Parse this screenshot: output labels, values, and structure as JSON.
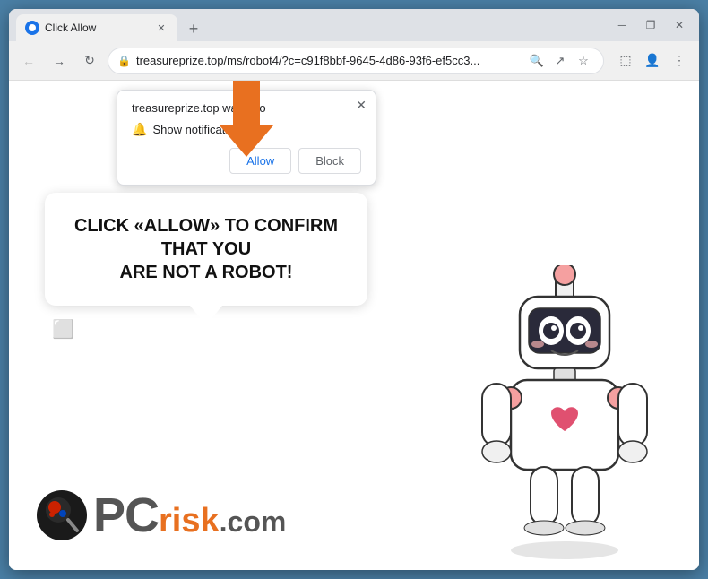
{
  "browser": {
    "tab_title": "Click Allow",
    "url": "treasureprize.top/ms/robot4/?c=c91f8bbf-9645-4d86-93f6-ef5cc3...",
    "url_full": "treasureprize.top/ms/robot4/?c=c91f8bbf-9645-4d86-93f6-ef5cc3..."
  },
  "notification": {
    "title": "treasureprize.top wants to",
    "show_notifications": "Show notifications",
    "allow_label": "Allow",
    "block_label": "Block"
  },
  "speech_bubble": {
    "line1": "CLICK «ALLOW» TO CONFIRM THAT YOU",
    "line2": "ARE NOT A ROBOT!",
    "text": "CLICK «ALLOW» TO CONFIRM THAT YOU ARE NOT A ROBOT!"
  },
  "logo": {
    "pc": "PC",
    "risk": "risk",
    "com": ".com"
  },
  "window_controls": {
    "minimize": "─",
    "restore": "□",
    "close": "✕"
  },
  "nav": {
    "back": "←",
    "forward": "→",
    "refresh": "↻",
    "search_icon": "🔍",
    "share_icon": "↗",
    "star_icon": "☆",
    "tab_icon": "⬜",
    "profile_icon": "👤",
    "menu_icon": "⋮"
  }
}
